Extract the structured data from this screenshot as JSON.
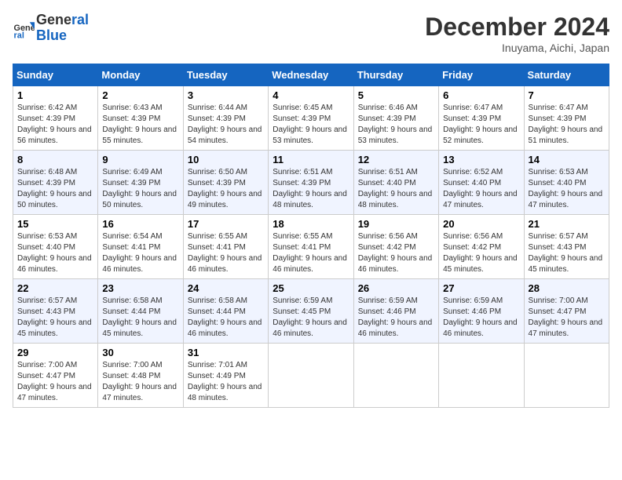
{
  "header": {
    "logo_line1": "General",
    "logo_line2": "Blue",
    "month_title": "December 2024",
    "location": "Inuyama, Aichi, Japan"
  },
  "columns": [
    "Sunday",
    "Monday",
    "Tuesday",
    "Wednesday",
    "Thursday",
    "Friday",
    "Saturday"
  ],
  "weeks": [
    [
      {
        "day": "1",
        "sunrise": "Sunrise: 6:42 AM",
        "sunset": "Sunset: 4:39 PM",
        "daylight": "Daylight: 9 hours and 56 minutes."
      },
      {
        "day": "2",
        "sunrise": "Sunrise: 6:43 AM",
        "sunset": "Sunset: 4:39 PM",
        "daylight": "Daylight: 9 hours and 55 minutes."
      },
      {
        "day": "3",
        "sunrise": "Sunrise: 6:44 AM",
        "sunset": "Sunset: 4:39 PM",
        "daylight": "Daylight: 9 hours and 54 minutes."
      },
      {
        "day": "4",
        "sunrise": "Sunrise: 6:45 AM",
        "sunset": "Sunset: 4:39 PM",
        "daylight": "Daylight: 9 hours and 53 minutes."
      },
      {
        "day": "5",
        "sunrise": "Sunrise: 6:46 AM",
        "sunset": "Sunset: 4:39 PM",
        "daylight": "Daylight: 9 hours and 53 minutes."
      },
      {
        "day": "6",
        "sunrise": "Sunrise: 6:47 AM",
        "sunset": "Sunset: 4:39 PM",
        "daylight": "Daylight: 9 hours and 52 minutes."
      },
      {
        "day": "7",
        "sunrise": "Sunrise: 6:47 AM",
        "sunset": "Sunset: 4:39 PM",
        "daylight": "Daylight: 9 hours and 51 minutes."
      }
    ],
    [
      {
        "day": "8",
        "sunrise": "Sunrise: 6:48 AM",
        "sunset": "Sunset: 4:39 PM",
        "daylight": "Daylight: 9 hours and 50 minutes."
      },
      {
        "day": "9",
        "sunrise": "Sunrise: 6:49 AM",
        "sunset": "Sunset: 4:39 PM",
        "daylight": "Daylight: 9 hours and 50 minutes."
      },
      {
        "day": "10",
        "sunrise": "Sunrise: 6:50 AM",
        "sunset": "Sunset: 4:39 PM",
        "daylight": "Daylight: 9 hours and 49 minutes."
      },
      {
        "day": "11",
        "sunrise": "Sunrise: 6:51 AM",
        "sunset": "Sunset: 4:39 PM",
        "daylight": "Daylight: 9 hours and 48 minutes."
      },
      {
        "day": "12",
        "sunrise": "Sunrise: 6:51 AM",
        "sunset": "Sunset: 4:40 PM",
        "daylight": "Daylight: 9 hours and 48 minutes."
      },
      {
        "day": "13",
        "sunrise": "Sunrise: 6:52 AM",
        "sunset": "Sunset: 4:40 PM",
        "daylight": "Daylight: 9 hours and 47 minutes."
      },
      {
        "day": "14",
        "sunrise": "Sunrise: 6:53 AM",
        "sunset": "Sunset: 4:40 PM",
        "daylight": "Daylight: 9 hours and 47 minutes."
      }
    ],
    [
      {
        "day": "15",
        "sunrise": "Sunrise: 6:53 AM",
        "sunset": "Sunset: 4:40 PM",
        "daylight": "Daylight: 9 hours and 46 minutes."
      },
      {
        "day": "16",
        "sunrise": "Sunrise: 6:54 AM",
        "sunset": "Sunset: 4:41 PM",
        "daylight": "Daylight: 9 hours and 46 minutes."
      },
      {
        "day": "17",
        "sunrise": "Sunrise: 6:55 AM",
        "sunset": "Sunset: 4:41 PM",
        "daylight": "Daylight: 9 hours and 46 minutes."
      },
      {
        "day": "18",
        "sunrise": "Sunrise: 6:55 AM",
        "sunset": "Sunset: 4:41 PM",
        "daylight": "Daylight: 9 hours and 46 minutes."
      },
      {
        "day": "19",
        "sunrise": "Sunrise: 6:56 AM",
        "sunset": "Sunset: 4:42 PM",
        "daylight": "Daylight: 9 hours and 46 minutes."
      },
      {
        "day": "20",
        "sunrise": "Sunrise: 6:56 AM",
        "sunset": "Sunset: 4:42 PM",
        "daylight": "Daylight: 9 hours and 45 minutes."
      },
      {
        "day": "21",
        "sunrise": "Sunrise: 6:57 AM",
        "sunset": "Sunset: 4:43 PM",
        "daylight": "Daylight: 9 hours and 45 minutes."
      }
    ],
    [
      {
        "day": "22",
        "sunrise": "Sunrise: 6:57 AM",
        "sunset": "Sunset: 4:43 PM",
        "daylight": "Daylight: 9 hours and 45 minutes."
      },
      {
        "day": "23",
        "sunrise": "Sunrise: 6:58 AM",
        "sunset": "Sunset: 4:44 PM",
        "daylight": "Daylight: 9 hours and 45 minutes."
      },
      {
        "day": "24",
        "sunrise": "Sunrise: 6:58 AM",
        "sunset": "Sunset: 4:44 PM",
        "daylight": "Daylight: 9 hours and 46 minutes."
      },
      {
        "day": "25",
        "sunrise": "Sunrise: 6:59 AM",
        "sunset": "Sunset: 4:45 PM",
        "daylight": "Daylight: 9 hours and 46 minutes."
      },
      {
        "day": "26",
        "sunrise": "Sunrise: 6:59 AM",
        "sunset": "Sunset: 4:46 PM",
        "daylight": "Daylight: 9 hours and 46 minutes."
      },
      {
        "day": "27",
        "sunrise": "Sunrise: 6:59 AM",
        "sunset": "Sunset: 4:46 PM",
        "daylight": "Daylight: 9 hours and 46 minutes."
      },
      {
        "day": "28",
        "sunrise": "Sunrise: 7:00 AM",
        "sunset": "Sunset: 4:47 PM",
        "daylight": "Daylight: 9 hours and 47 minutes."
      }
    ],
    [
      {
        "day": "29",
        "sunrise": "Sunrise: 7:00 AM",
        "sunset": "Sunset: 4:47 PM",
        "daylight": "Daylight: 9 hours and 47 minutes."
      },
      {
        "day": "30",
        "sunrise": "Sunrise: 7:00 AM",
        "sunset": "Sunset: 4:48 PM",
        "daylight": "Daylight: 9 hours and 47 minutes."
      },
      {
        "day": "31",
        "sunrise": "Sunrise: 7:01 AM",
        "sunset": "Sunset: 4:49 PM",
        "daylight": "Daylight: 9 hours and 48 minutes."
      },
      null,
      null,
      null,
      null
    ]
  ]
}
